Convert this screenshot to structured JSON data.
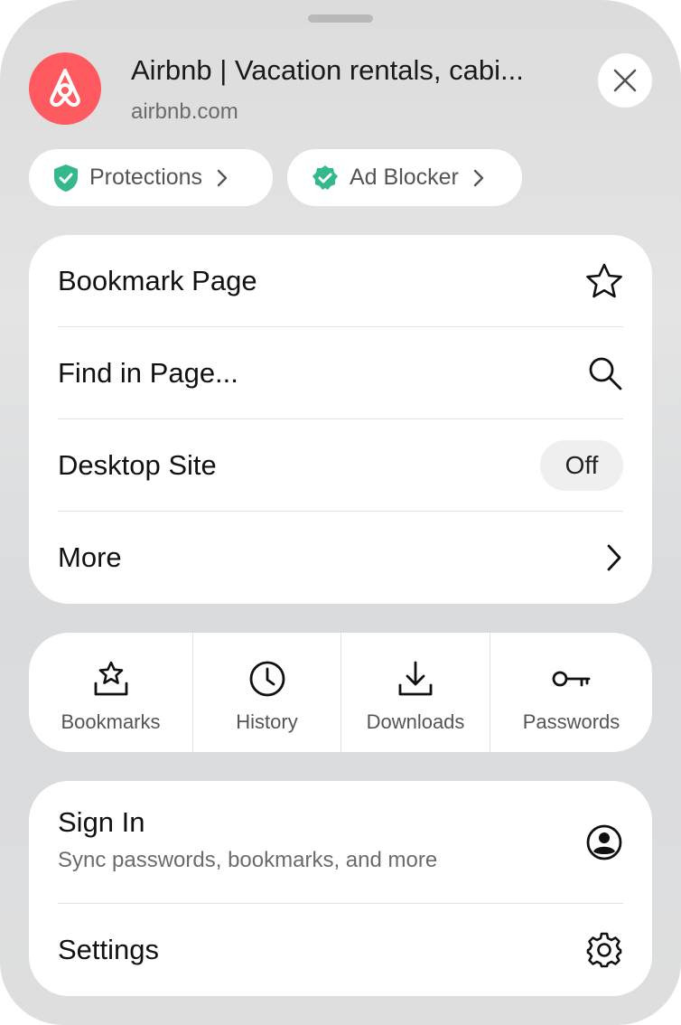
{
  "header": {
    "site_title": "Airbnb | Vacation rentals, cabi...",
    "site_host": "airbnb.com",
    "logo_icon": "airbnb-logo-icon",
    "brand_color": "#ff5a5f"
  },
  "chips": {
    "protections": "Protections",
    "ad_blocker": "Ad Blocker",
    "shield_color": "#35b88c"
  },
  "menu": {
    "bookmark_page": "Bookmark Page",
    "find_in_page": "Find in Page...",
    "desktop_site": "Desktop Site",
    "desktop_site_state": "Off",
    "more": "More"
  },
  "shortcuts": [
    {
      "label": "Bookmarks",
      "icon": "bookmark-star-tray-icon"
    },
    {
      "label": "History",
      "icon": "clock-icon"
    },
    {
      "label": "Downloads",
      "icon": "download-icon"
    },
    {
      "label": "Passwords",
      "icon": "key-icon"
    }
  ],
  "account": {
    "sign_in": "Sign In",
    "sign_in_sub": "Sync passwords, bookmarks, and more",
    "settings": "Settings"
  }
}
